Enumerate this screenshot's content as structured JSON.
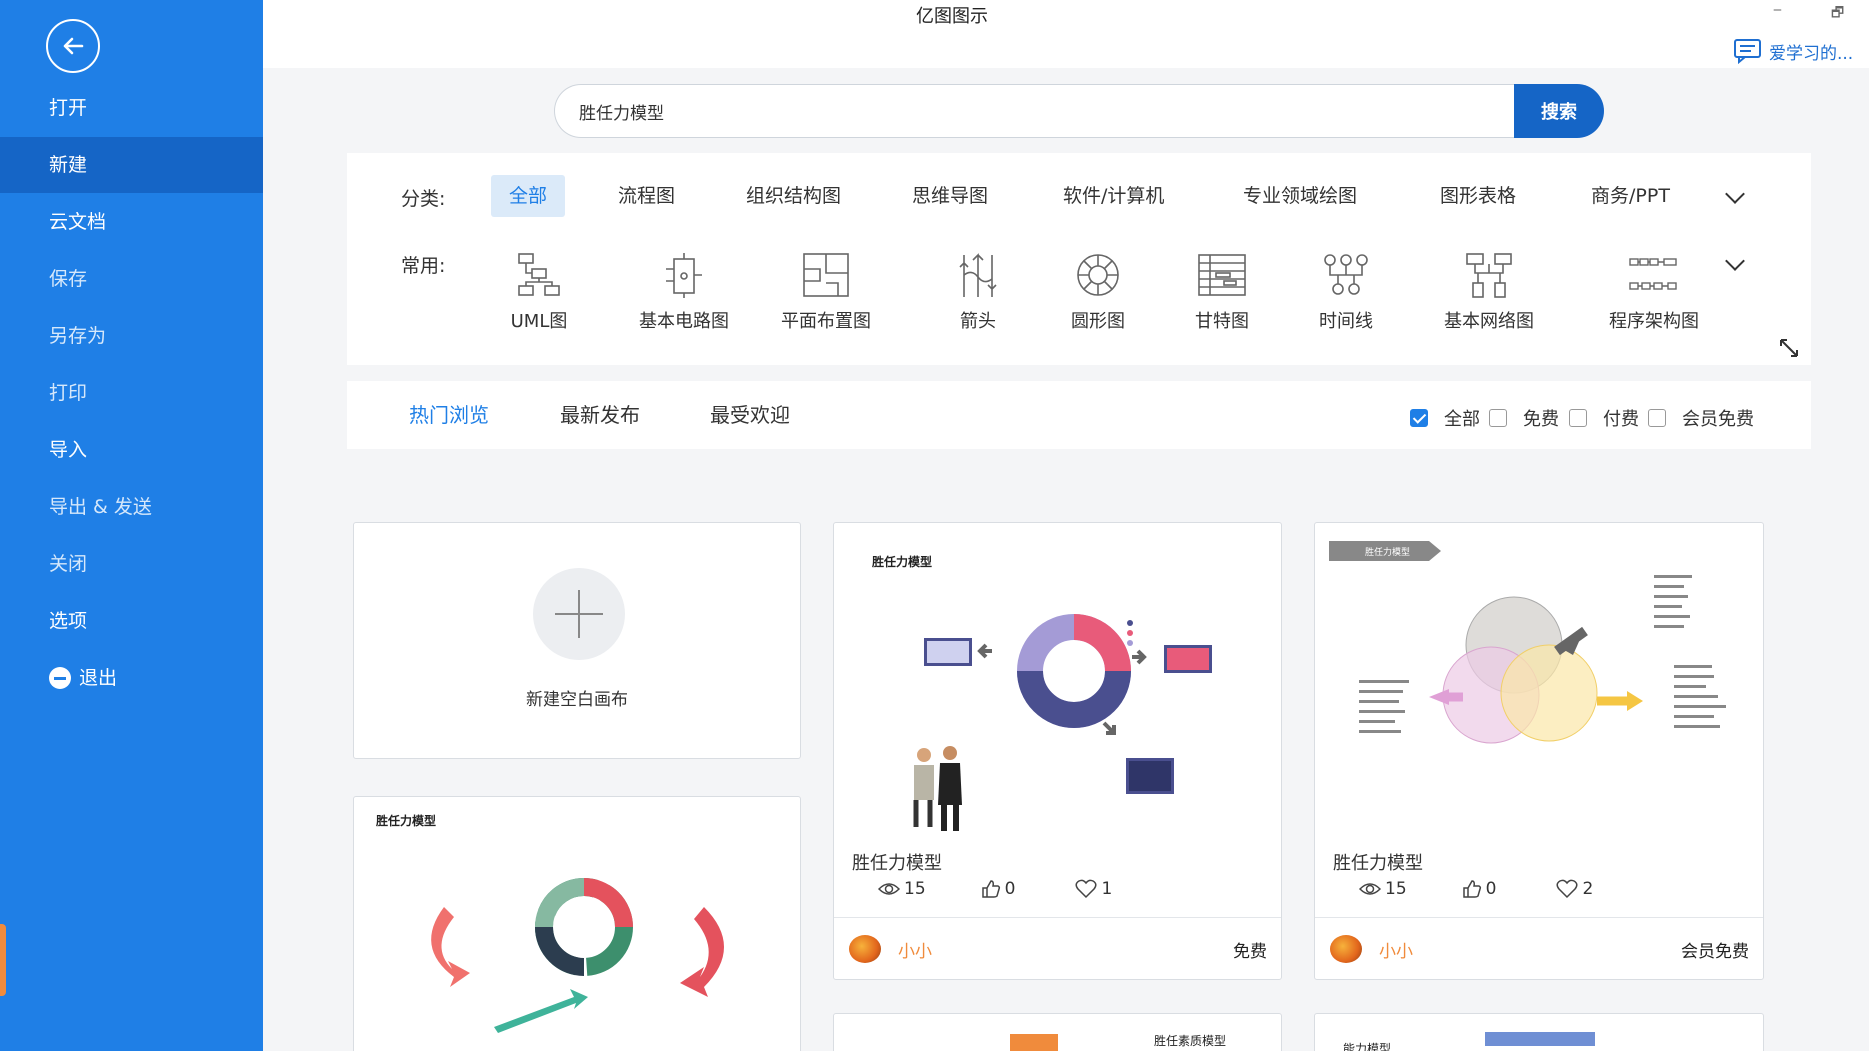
{
  "sidebar": {
    "items": [
      {
        "label": "打开"
      },
      {
        "label": "新建"
      },
      {
        "label": "云文档"
      },
      {
        "label": "保存"
      },
      {
        "label": "另存为"
      },
      {
        "label": "打印"
      },
      {
        "label": "导入"
      },
      {
        "label": "导出 & 发送"
      },
      {
        "label": "关闭"
      },
      {
        "label": "选项"
      },
      {
        "label": "退出"
      }
    ]
  },
  "window": {
    "title": "亿图图示",
    "minimize": "‒",
    "restore": "🗗",
    "user_label": "爱学习的..."
  },
  "search": {
    "value": "胜任力模型",
    "button": "搜索"
  },
  "categories": {
    "label": "分类:",
    "tabs": [
      "全部",
      "流程图",
      "组织结构图",
      "思维导图",
      "软件/计算机",
      "专业领域绘图",
      "图形表格",
      "商务/PPT"
    ]
  },
  "common": {
    "label": "常用:",
    "items": [
      "UML图",
      "基本电路图",
      "平面布置图",
      "箭头",
      "圆形图",
      "甘特图",
      "时间线",
      "基本网络图",
      "程序架构图"
    ]
  },
  "filters": {
    "tabs": [
      "热门浏览",
      "最新发布",
      "最受欢迎"
    ],
    "checks": [
      "全部",
      "免费",
      "付费",
      "会员免费"
    ]
  },
  "cards": {
    "new_blank": "新建空白画布",
    "card1": {
      "title": "胜任力模型",
      "views": "15",
      "likes": "0",
      "favs": "1",
      "author": "小小",
      "price": "免费",
      "thumb_title": "胜任力模型"
    },
    "card2": {
      "title": "胜任力模型",
      "views": "15",
      "likes": "0",
      "favs": "2",
      "author": "小小",
      "price": "会员免费",
      "thumb_title": "胜任力模型"
    },
    "card3": {
      "thumb_title": "胜任力模型"
    },
    "card4": {
      "thumb_title": "胜任素质模型"
    },
    "card5": {
      "thumb_title": "能力模型"
    }
  },
  "colors": {
    "sidebar": "#1f7fe6",
    "accent": "#1565c6",
    "author": "#f08b3c"
  }
}
